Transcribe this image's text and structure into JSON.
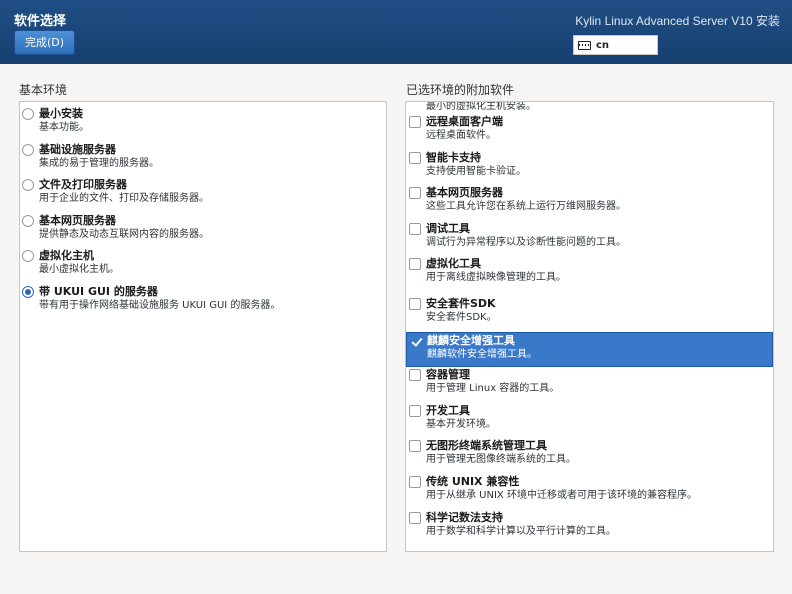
{
  "header": {
    "title": "软件选择",
    "done_label": "完成(D)",
    "product": "Kylin Linux Advanced Server V10 安装",
    "keyboard_layout": "cn"
  },
  "base_env": {
    "label": "基本环境",
    "items": [
      {
        "name": "最小安装",
        "desc": "基本功能。",
        "selected": false
      },
      {
        "name": "基础设施服务器",
        "desc": "集成的易于管理的服务器。",
        "selected": false
      },
      {
        "name": "文件及打印服务器",
        "desc": "用于企业的文件、打印及存储服务器。",
        "selected": false
      },
      {
        "name": "基本网页服务器",
        "desc": "提供静态及动态互联网内容的服务器。",
        "selected": false
      },
      {
        "name": "虚拟化主机",
        "desc": "最小虚拟化主机。",
        "selected": false
      },
      {
        "name": "带 UKUI GUI 的服务器",
        "desc": "带有用于操作网络基础设施服务 UKUI GUI 的服务器。",
        "selected": true
      }
    ]
  },
  "addons": {
    "label": "已选环境的附加软件",
    "cut_top_desc": "最小的虚拟化主机安装。",
    "items": [
      {
        "name": "远程桌面客户端",
        "desc": "远程桌面软件。",
        "checked": false
      },
      {
        "name": "智能卡支持",
        "desc": "支持使用智能卡验证。",
        "checked": false
      },
      {
        "name": "基本网页服务器",
        "desc": "这些工具允许您在系统上运行万维网服务器。",
        "checked": false
      },
      {
        "name": "调试工具",
        "desc": "调试行为异常程序以及诊断性能问题的工具。",
        "checked": false
      },
      {
        "name": "虚拟化工具",
        "desc": "用于离线虚拟映像管理的工具。",
        "checked": false
      },
      {
        "name": "安全套件SDK",
        "desc": "安全套件SDK。",
        "checked": false
      },
      {
        "name": "麒麟安全增强工具",
        "desc": "麒麟软件安全增强工具。",
        "checked": true
      },
      {
        "name": "容器管理",
        "desc": "用于管理 Linux 容器的工具。",
        "checked": false
      },
      {
        "name": "开发工具",
        "desc": "基本开发环境。",
        "checked": false
      },
      {
        "name": "无图形终端系统管理工具",
        "desc": "用于管理无图像终端系统的工具。",
        "checked": false
      },
      {
        "name": "传统 UNIX 兼容性",
        "desc": "用于从继承 UNIX 环境中迁移或者可用于该环境的兼容程序。",
        "checked": false
      },
      {
        "name": "科学记数法支持",
        "desc": "用于数学和科学计算以及平行计算的工具。",
        "checked": false
      }
    ]
  }
}
